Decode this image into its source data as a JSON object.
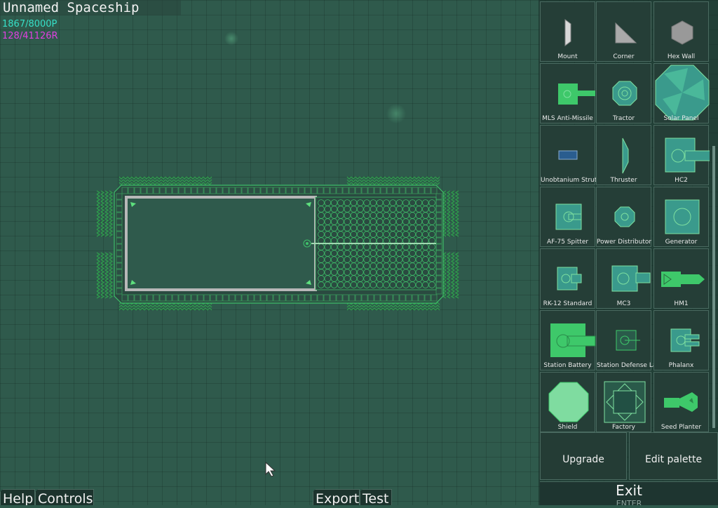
{
  "ship": {
    "name": "Unnamed Spaceship",
    "power": "1867/8000P",
    "resources": "128/41126R"
  },
  "palette": {
    "items": [
      {
        "label": "Mount",
        "icon": "mount-icon"
      },
      {
        "label": "Corner",
        "icon": "corner-icon"
      },
      {
        "label": "Hex Wall",
        "icon": "hex-wall-icon"
      },
      {
        "label": "MLS Anti-Missile",
        "icon": "anti-missile-icon"
      },
      {
        "label": "Tractor",
        "icon": "tractor-icon"
      },
      {
        "label": "Solar Panel",
        "icon": "solar-panel-icon"
      },
      {
        "label": "Unobtanium Strut",
        "icon": "strut-icon"
      },
      {
        "label": "Thruster",
        "icon": "thruster-icon"
      },
      {
        "label": "HC2",
        "icon": "hc2-icon"
      },
      {
        "label": "AF-75 Spitter",
        "icon": "spitter-icon"
      },
      {
        "label": "Power Distributor",
        "icon": "power-distributor-icon"
      },
      {
        "label": "Generator",
        "icon": "generator-icon"
      },
      {
        "label": "RK-12 Standard",
        "icon": "rk12-icon"
      },
      {
        "label": "MC3",
        "icon": "mc3-icon"
      },
      {
        "label": "HM1",
        "icon": "hm1-icon"
      },
      {
        "label": "Station Battery",
        "icon": "battery-icon"
      },
      {
        "label": "Station Defense Laser",
        "icon": "laser-icon"
      },
      {
        "label": "Phalanx",
        "icon": "phalanx-icon"
      },
      {
        "label": "Shield",
        "icon": "shield-icon"
      },
      {
        "label": "Factory",
        "icon": "factory-icon"
      },
      {
        "label": "Seed Planter",
        "icon": "seed-planter-icon"
      }
    ]
  },
  "buttons": {
    "upgrade": "Upgrade",
    "edit_palette": "Edit palette",
    "exit": "Exit",
    "exit_hint": "ENTER",
    "help": "Help",
    "controls": "Controls",
    "export": "Export",
    "test": "Test"
  },
  "colors": {
    "background": "#2f5a4c",
    "power_text": "#36e0c8",
    "resource_text": "#e040e0",
    "part_green": "#3ec86a",
    "part_teal": "#3a9a8c"
  }
}
